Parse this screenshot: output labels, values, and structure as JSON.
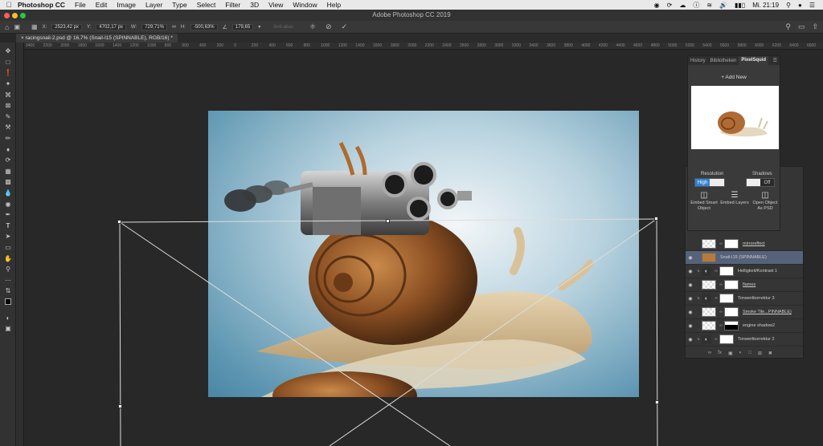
{
  "menubar": {
    "app": "Photoshop CC",
    "menus": [
      "File",
      "Edit",
      "Image",
      "Layer",
      "Type",
      "Select",
      "Filter",
      "3D",
      "View",
      "Window",
      "Help"
    ],
    "clock": "Mi. 21:19"
  },
  "window": {
    "title": "Adobe Photoshop CC 2019"
  },
  "options": {
    "x_label": "X:",
    "x_value": "2523,42 px",
    "y_label": "Y:",
    "y_value": "4702,17 px",
    "w_label": "W:",
    "w_value": "729,71%",
    "h_label": "H:",
    "h_value": "-500,63%",
    "angle_value": "179,65",
    "antialias_label": "Anti-alias"
  },
  "document": {
    "tab_title": "racingsnail-2.psd @ 16,7% (Snail-I15 (SPINNABLE), RGB/16) *"
  },
  "ruler": {
    "ticks": [
      "2400",
      "2200",
      "2000",
      "1800",
      "1600",
      "1400",
      "1200",
      "1000",
      "800",
      "600",
      "400",
      "200",
      "0",
      "200",
      "400",
      "600",
      "800",
      "1000",
      "1200",
      "1400",
      "1600",
      "1800",
      "2000",
      "2200",
      "2400",
      "2600",
      "2800",
      "3000",
      "3200",
      "3400",
      "3600",
      "3800",
      "4000",
      "4200",
      "4400",
      "4600",
      "4800",
      "5000",
      "5200",
      "5400",
      "5600",
      "5800",
      "6000",
      "6200",
      "6400",
      "6600"
    ]
  },
  "pixelsquid": {
    "tabs": [
      "History",
      "Bibliotheken",
      "PixelSquid"
    ],
    "add_new": "+ Add New",
    "resolution_label": "Resolution",
    "resolution_value": "High",
    "shadows_label": "Shadows",
    "shadows_value": "Off",
    "actions": [
      "Embed Smart Object",
      "Embed Layers",
      "Open Object As PSD"
    ]
  },
  "layers": [
    {
      "name": "mirroreffect",
      "thumb": "checker",
      "mask": "white",
      "selected": false,
      "adj": false,
      "underline": true
    },
    {
      "name": "Snail-I15 (SPINNABLE)",
      "thumb": "snail",
      "mask": "none",
      "selected": true,
      "adj": false,
      "underline": false
    },
    {
      "name": "Helligkeit/Kontrast 1",
      "thumb": "adj",
      "mask": "white",
      "selected": false,
      "adj": true,
      "underline": false
    },
    {
      "name": "flames",
      "thumb": "checker",
      "mask": "white",
      "selected": false,
      "adj": false,
      "underline": true
    },
    {
      "name": "Tonwertkorrektur 3",
      "thumb": "adj",
      "mask": "white",
      "selected": false,
      "adj": true,
      "underline": false
    },
    {
      "name": "Smoke Tile...PINNABLE)",
      "thumb": "checker",
      "mask": "white",
      "selected": false,
      "adj": false,
      "underline": true
    },
    {
      "name": "engine shadow2",
      "thumb": "checker",
      "mask": "black",
      "selected": false,
      "adj": false,
      "underline": false
    },
    {
      "name": "Tonwertkorrektur 2",
      "thumb": "adj",
      "mask": "white",
      "selected": false,
      "adj": true,
      "underline": false
    }
  ]
}
